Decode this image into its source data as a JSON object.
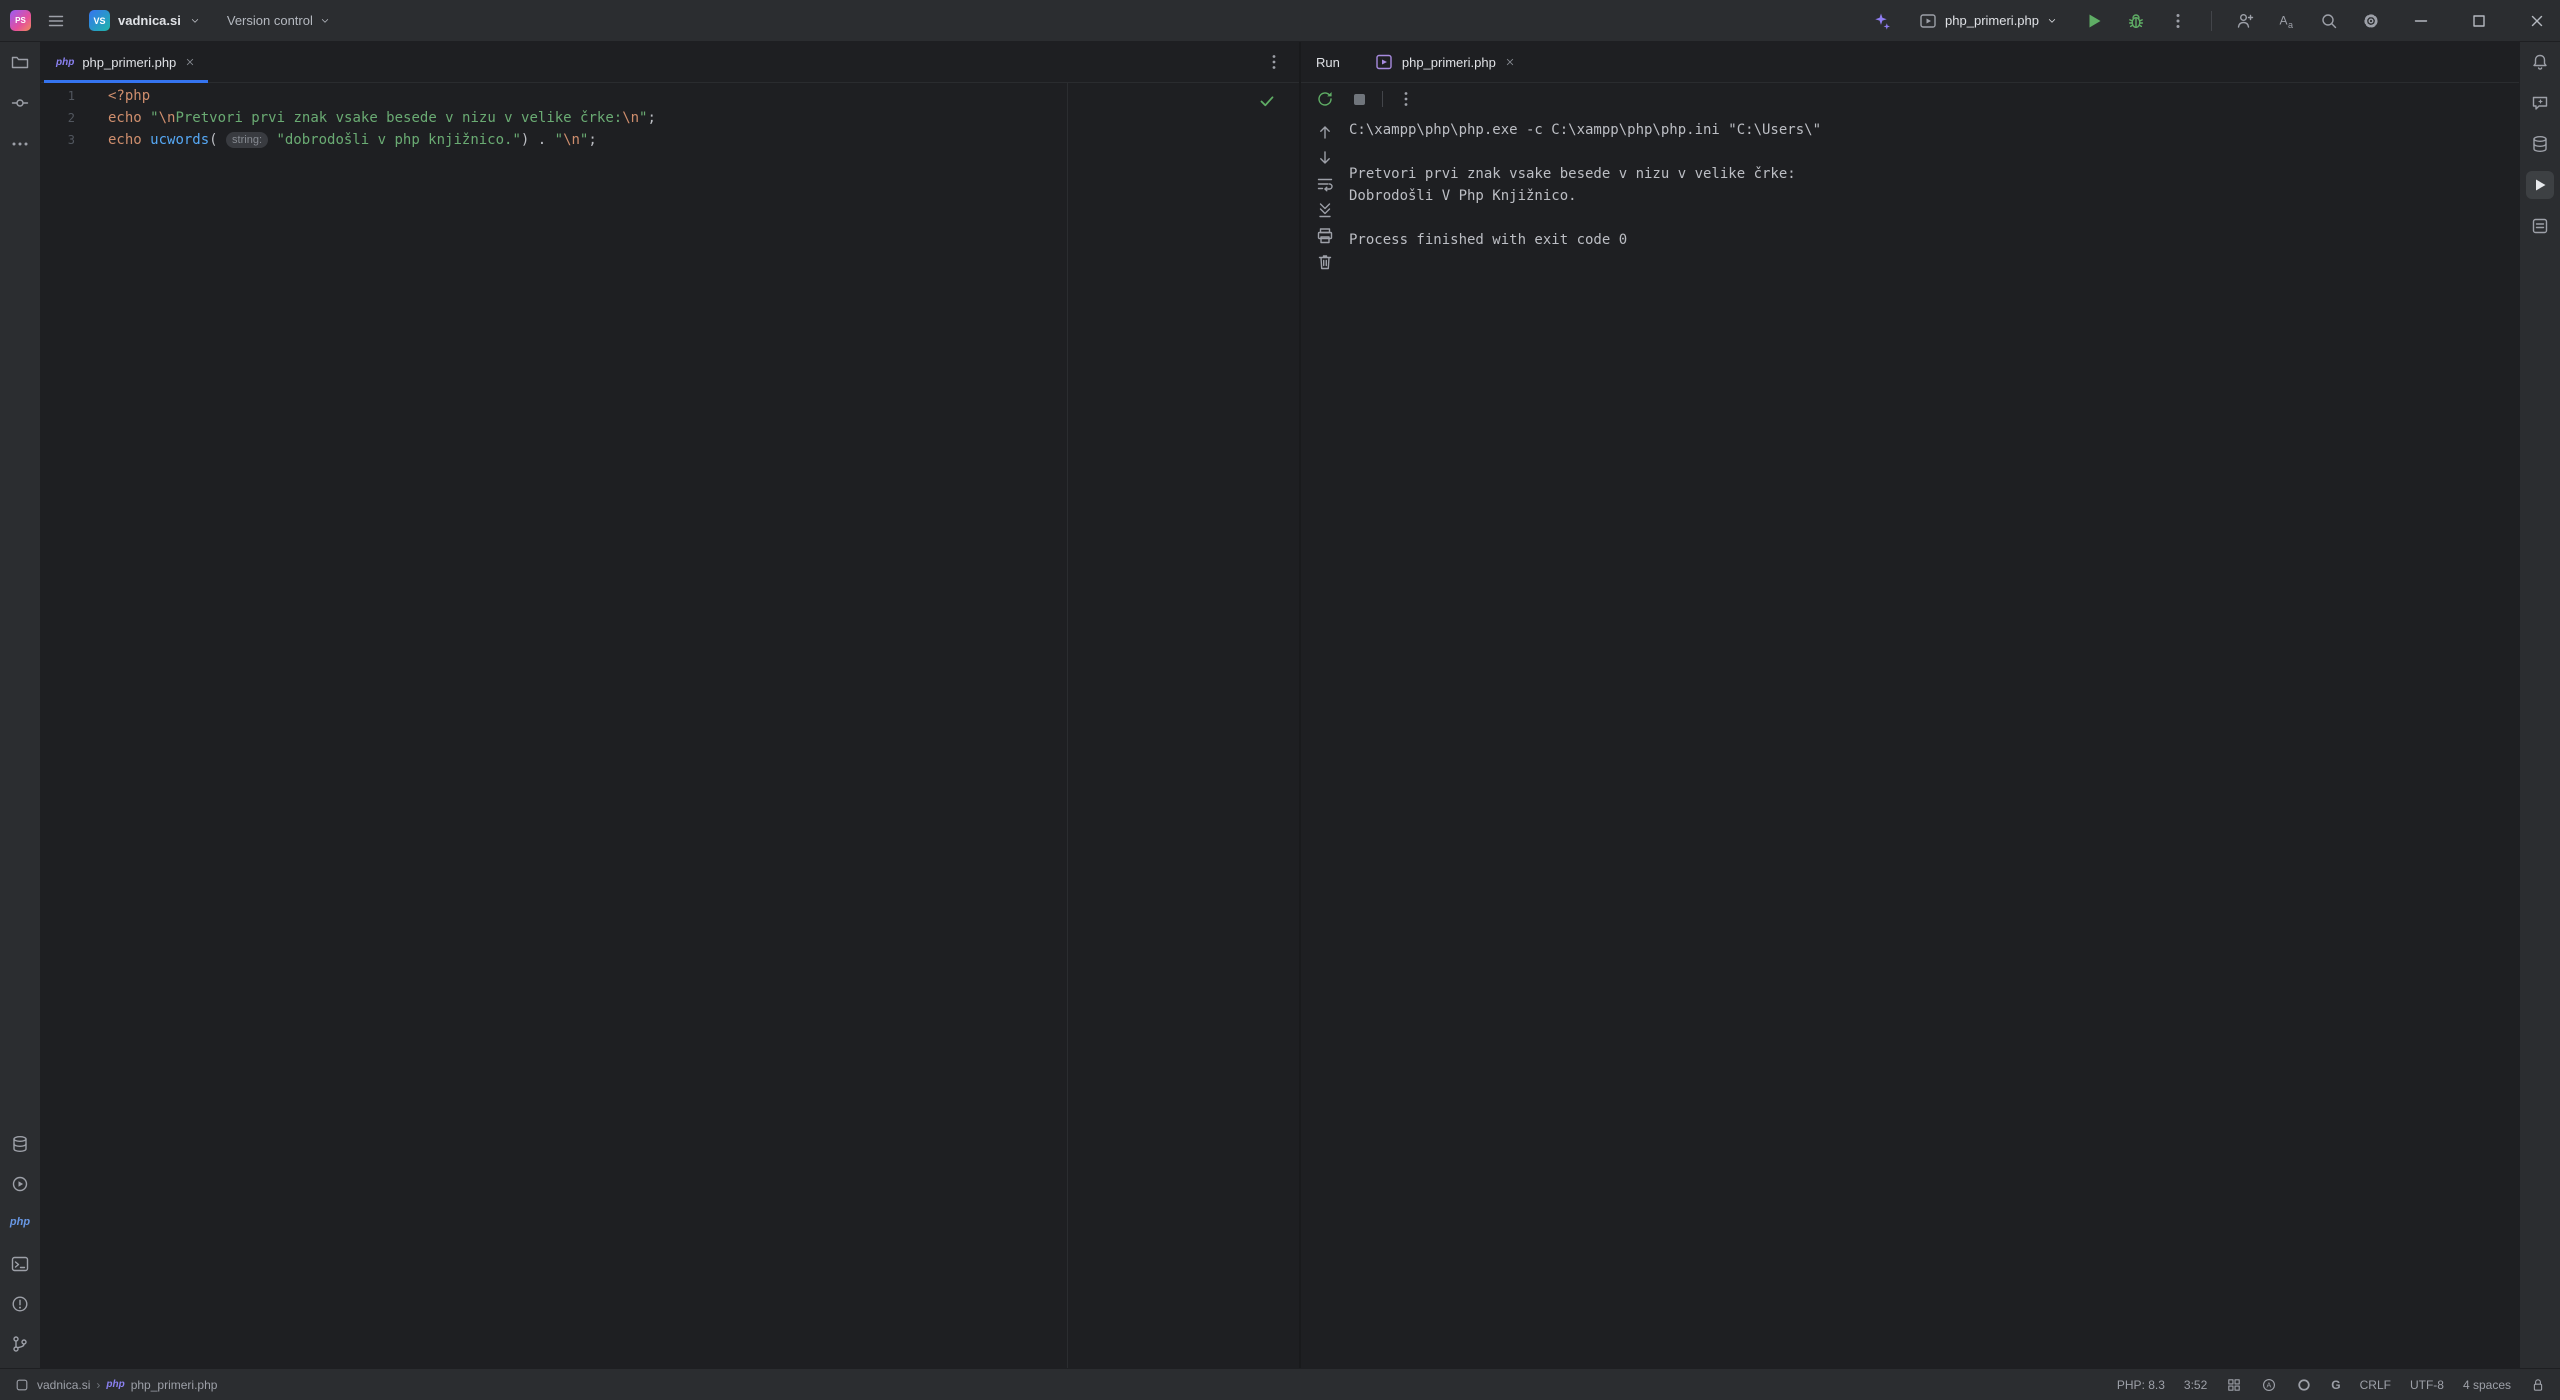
{
  "colors": {
    "accent": "#3574f0",
    "run_green": "#5fad65",
    "keyword_orange": "#cf8e6d",
    "string_green": "#6aab73",
    "function_blue": "#56a8f5",
    "editor_bg": "#1e1f22",
    "panel_bg": "#2b2d30"
  },
  "titlebar": {
    "project_name": "vadnica.si",
    "project_avatar": "VS",
    "version_control_label": "Version control",
    "run_config_label": "php_primeri.php"
  },
  "editor": {
    "tab_label": "php_primeri.php",
    "file_icon_label": "php",
    "lines": [
      {
        "num": "1",
        "tokens": [
          [
            "<?php",
            "k"
          ]
        ]
      },
      {
        "num": "2",
        "tokens": [
          [
            "echo ",
            "k"
          ],
          [
            "\"",
            "s"
          ],
          [
            "\\n",
            "e"
          ],
          [
            "Pretvori prvi znak vsake besede v nizu v velike črke:",
            "s"
          ],
          [
            "\\n",
            "e"
          ],
          [
            "\"",
            "s"
          ],
          [
            ";",
            "p"
          ]
        ]
      },
      {
        "num": "3",
        "tokens": [
          [
            "echo ",
            "k"
          ],
          [
            "ucwords",
            "f"
          ],
          [
            "(",
            "p"
          ],
          [
            " ",
            "p"
          ],
          [
            "string:",
            "h"
          ],
          [
            " ",
            "p"
          ],
          [
            "\"dobrodošli v php knjižnico.\"",
            "s"
          ],
          [
            ")",
            "p"
          ],
          [
            " . ",
            "p"
          ],
          [
            "\"",
            "s"
          ],
          [
            "\\n",
            "e"
          ],
          [
            "\"",
            "s"
          ],
          [
            ";",
            "p"
          ]
        ]
      }
    ]
  },
  "run_panel": {
    "title": "Run",
    "tab_label": "php_primeri.php",
    "console_lines": [
      "C:\\xampp\\php\\php.exe -c C:\\xampp\\php\\php.ini \"C:\\Users\\\"",
      "",
      "Pretvori prvi znak vsake besede v nizu v velike črke:",
      "Dobrodošli V Php Knjižnico.",
      "",
      "Process finished with exit code 0"
    ]
  },
  "statusbar": {
    "breadcrumb_project": "vadnica.si",
    "breadcrumb_file": "php_primeri.php",
    "php_version": "PHP: 8.3",
    "cursor_position": "3:52",
    "line_separator": "CRLF",
    "encoding": "UTF-8",
    "indent": "4 spaces",
    "grazie_letter": "G"
  },
  "icons": {
    "php_badge": "php"
  }
}
